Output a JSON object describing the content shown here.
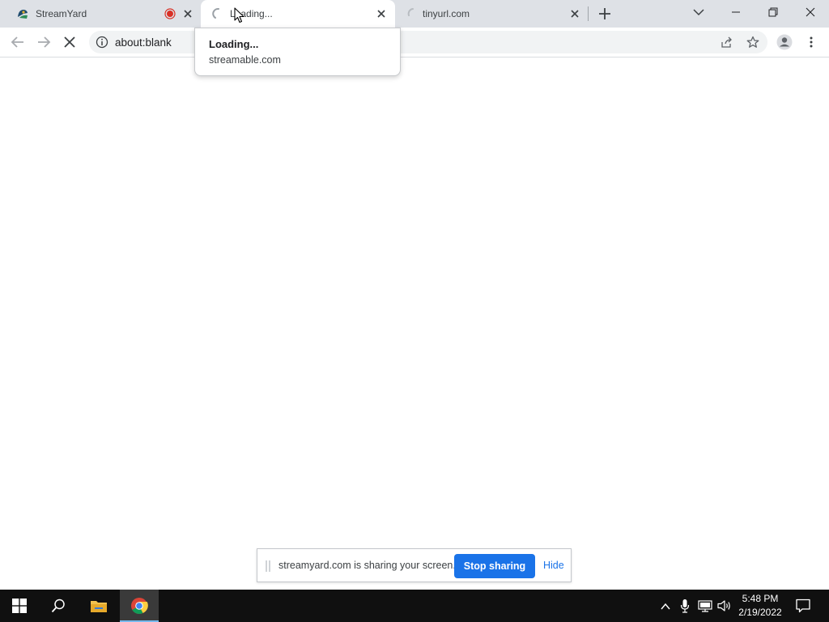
{
  "tabs": [
    {
      "title": "StreamYard",
      "icon": "streamyard-favicon",
      "indicator": "recording-dot"
    },
    {
      "title": "Loading...",
      "icon": "loading-spinner",
      "active": true
    },
    {
      "title": "tinyurl.com",
      "icon": "loading-spinner"
    }
  ],
  "toolbar": {
    "url": "about:blank"
  },
  "hover_card": {
    "title": "Loading...",
    "domain": "streamable.com"
  },
  "share_bar": {
    "message": "streamyard.com is sharing your screen.",
    "stop_label": "Stop sharing",
    "hide_label": "Hide"
  },
  "taskbar": {
    "time": "5:48 PM",
    "date": "2/19/2022"
  },
  "colors": {
    "accent": "#1a73e8",
    "recording": "#d93025",
    "tabstrip": "#dee1e6",
    "taskbar": "#101010"
  }
}
